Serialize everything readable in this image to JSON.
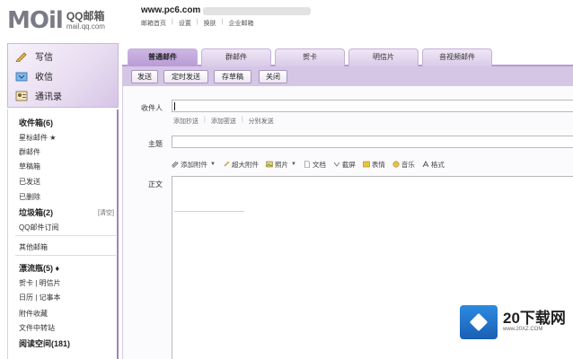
{
  "header": {
    "logo_big": "MOil",
    "logo_title": "QQ邮箱",
    "logo_domain": "mail.qq.com",
    "site": "www.pc6.com",
    "links": [
      "邮箱首页",
      "设置",
      "换肤",
      "企业邮箱"
    ]
  },
  "sidebar": {
    "actions": [
      {
        "label": "写信",
        "icon": "pencil-icon"
      },
      {
        "label": "收信",
        "icon": "inbox-icon"
      },
      {
        "label": "通讯录",
        "icon": "contacts-icon"
      }
    ],
    "items": [
      {
        "label": "收件箱(6)",
        "bold": true
      },
      {
        "label": "星标邮件 ★",
        "bold": false
      },
      {
        "label": "群邮件",
        "bold": false
      },
      {
        "label": "草稿箱",
        "bold": false
      },
      {
        "label": "已发送",
        "bold": false
      },
      {
        "label": "已删除",
        "bold": false
      },
      {
        "label": "垃圾箱(2)",
        "bold": true
      },
      {
        "label": "QQ邮件订阅",
        "bold": false
      },
      {
        "label": "其他邮箱",
        "bold": false
      },
      {
        "label": "漂流瓶(5) ♦",
        "bold": true
      },
      {
        "label": "贺卡 | 明信片",
        "bold": false
      },
      {
        "label": "日历 | 记事本",
        "bold": false
      },
      {
        "label": "附件收藏",
        "bold": false
      },
      {
        "label": "文件中转站",
        "bold": false
      },
      {
        "label": "阅读空间(181)",
        "bold": true
      }
    ],
    "clear_label": "[清空]"
  },
  "tabs": [
    {
      "label": "普通邮件",
      "active": true
    },
    {
      "label": "群邮件",
      "active": false
    },
    {
      "label": "贺卡",
      "active": false
    },
    {
      "label": "明信片",
      "active": false
    },
    {
      "label": "音视频邮件",
      "active": false
    }
  ],
  "toolbar": [
    "发送",
    "定时发送",
    "存草稿",
    "关闭"
  ],
  "form": {
    "recipient_label": "收件人",
    "recipient_links": [
      "添加抄送",
      "添加密送",
      "分别发送"
    ],
    "subject_label": "主题",
    "body_label": "正文",
    "attach_items": [
      {
        "label": "添加附件",
        "icon": "paperclip-icon",
        "arrow": true
      },
      {
        "label": "超大附件",
        "icon": "big-attachment-icon",
        "arrow": false
      },
      {
        "label": "照片",
        "icon": "photo-icon",
        "arrow": true
      },
      {
        "label": "文档",
        "icon": "document-icon",
        "arrow": false
      },
      {
        "label": "截屏",
        "icon": "screenshot-icon",
        "arrow": false
      },
      {
        "label": "表情",
        "icon": "emoticon-icon",
        "arrow": false
      },
      {
        "label": "音乐",
        "icon": "music-icon",
        "arrow": false
      },
      {
        "label": "格式",
        "icon": "format-icon",
        "arrow": false
      }
    ]
  },
  "watermark": {
    "big": "20下载网",
    "small": "www.20XZ.COM"
  },
  "colors": {
    "accent": "#b89bd6",
    "toolbar": "#d5c6e6",
    "sidebar_border": "#9d86b7"
  }
}
